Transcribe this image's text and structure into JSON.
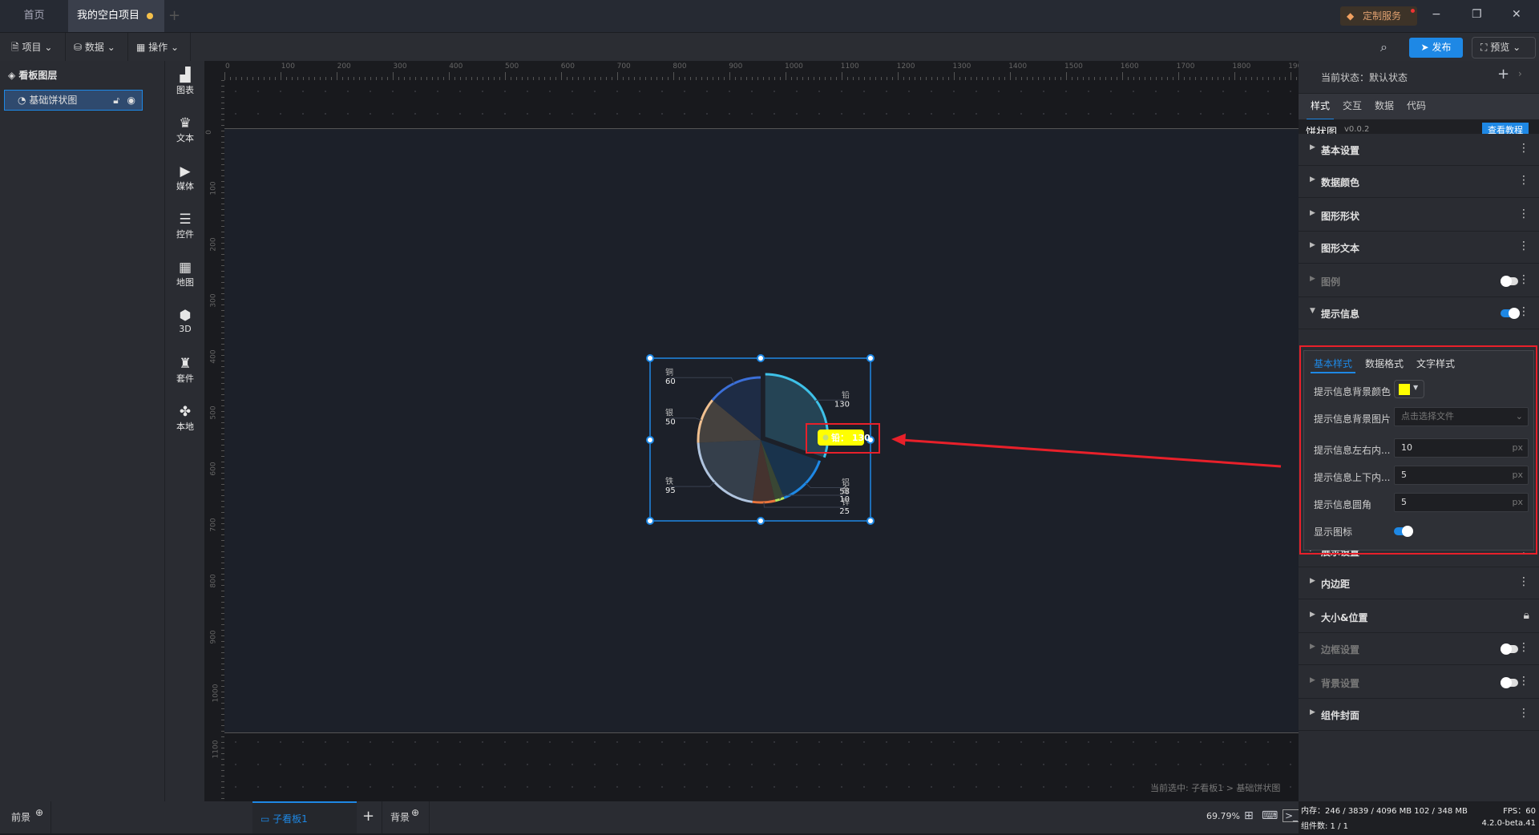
{
  "tabs": [
    {
      "label": "首页"
    },
    {
      "label": "我的空白项目"
    }
  ],
  "titlebar": {
    "service": "定制服务",
    "minimize": "−",
    "restore": "❐",
    "close": "✕"
  },
  "toolbar": {
    "project": "项目",
    "data": "数据",
    "operate": "操作",
    "publish": "发布",
    "preview": "预览"
  },
  "layers": {
    "title": "看板图层",
    "items": [
      {
        "label": "基础饼状图"
      }
    ]
  },
  "components": [
    {
      "label": "图表",
      "icon": "▟"
    },
    {
      "label": "文本",
      "icon": "♛"
    },
    {
      "label": "媒体",
      "icon": "▶"
    },
    {
      "label": "控件",
      "icon": "☰"
    },
    {
      "label": "地图",
      "icon": "▦"
    },
    {
      "label": "3D",
      "icon": "⬢"
    },
    {
      "label": "套件",
      "icon": "♜"
    },
    {
      "label": "本地",
      "icon": "✤"
    }
  ],
  "ruler": {
    "h": [
      "0",
      "100",
      "200",
      "300",
      "400",
      "500",
      "600",
      "700",
      "800",
      "900",
      "1000",
      "1100",
      "1200",
      "1300",
      "1400",
      "1500",
      "1600",
      "1700",
      "1800",
      "1900"
    ],
    "v": [
      "0",
      "100",
      "200",
      "300",
      "400",
      "500",
      "600",
      "700",
      "800",
      "900",
      "1000",
      "1100"
    ]
  },
  "chart_data": {
    "type": "pie",
    "categories": [
      "铅",
      "铝",
      "金",
      "锌",
      "铁",
      "银",
      "铜"
    ],
    "values": [
      130,
      58,
      10,
      25,
      95,
      50,
      60
    ],
    "tooltip": {
      "name": "铅",
      "value": "130",
      "separator": "："
    }
  },
  "colors": {
    "accent": "#1e88e5",
    "tooltip_bg": "#ffff00",
    "highlight": "#e8202a",
    "pie_stroke": [
      "#3ec1e8",
      "#1e88e5",
      "#b5e65a",
      "#e8743b",
      "#b0c4de",
      "#f0c090",
      "#3b6fd8"
    ],
    "pie_fill": [
      "#27485a",
      "#1a3550",
      "#3d4a35",
      "#4a3530",
      "#39424f",
      "#4a4540",
      "#1f2d48"
    ]
  },
  "right": {
    "state_label": "当前状态：默认状态",
    "tabs": [
      "样式",
      "交互",
      "数据",
      "代码"
    ],
    "component": "饼状图",
    "version": "v0.0.2",
    "tutorial": "查看教程",
    "sections": [
      "基本设置",
      "数据颜色",
      "图形形状",
      "图形文本",
      "图例",
      "提示信息"
    ],
    "sections2": [
      "展示设置",
      "内边距",
      "大小&位置",
      "边框设置",
      "背景设置",
      "组件封面"
    ],
    "subtabs": [
      "基本样式",
      "数据格式",
      "文字样式"
    ],
    "fields": {
      "bg_color": "提示信息背景颜色",
      "bg_image": "提示信息背景图片",
      "bg_image_placeholder": "点击选择文件",
      "pad_lr": "提示信息左右内...",
      "pad_lr_val": "10",
      "pad_tb": "提示信息上下内...",
      "pad_tb_val": "5",
      "radius": "提示信息圆角",
      "radius_val": "5",
      "unit": "px",
      "show_icon": "显示图标"
    }
  },
  "bottom": {
    "front": "前景",
    "board": "子看板1",
    "back": "背景",
    "zoom": "69.79%",
    "selected": "当前选中: 子看板1 > 基础饼状图",
    "memory": "内存：246 / 3839 / 4096 MB  102 / 348 MB",
    "fps": "FPS：60",
    "count": "组件数: 1 / 1",
    "version": "4.2.0-beta.41"
  }
}
